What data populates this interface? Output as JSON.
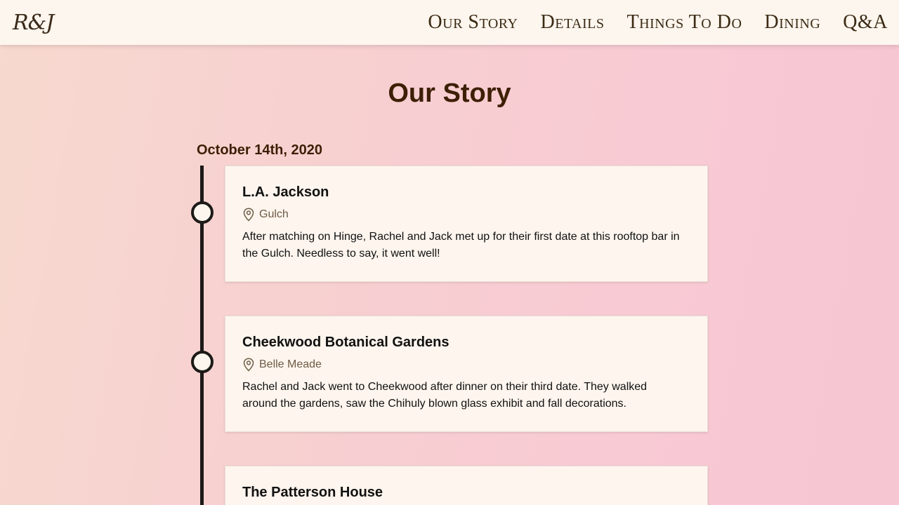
{
  "header": {
    "logo": "R&J",
    "nav": [
      {
        "label": "Our Story"
      },
      {
        "label": "Details"
      },
      {
        "label": "Things To Do"
      },
      {
        "label": "Dining"
      },
      {
        "label": "Q&A"
      }
    ]
  },
  "main": {
    "title": "Our Story",
    "date": "October 14th, 2020",
    "events": [
      {
        "title": "L.A. Jackson",
        "location": "Gulch",
        "location_icon": "map-pin-icon",
        "description": "After matching on Hinge, Rachel and Jack met up for their first date at this rooftop bar in the Gulch. Needless to say, it went well!"
      },
      {
        "title": "Cheekwood Botanical Gardens",
        "location": "Belle Meade",
        "location_icon": "map-pin-icon",
        "description": "Rachel and Jack went to Cheekwood after dinner on their third date. They walked around the gardens, saw the Chihuly blown glass exhibit and fall decorations."
      },
      {
        "title": "The Patterson House"
      }
    ]
  },
  "colors": {
    "heading": "#3d1f05",
    "nav_bg": "#fdf6ee",
    "card_bg": "#fdf5ee",
    "timeline": "#1c1a18",
    "location_text": "#6e5b45"
  }
}
